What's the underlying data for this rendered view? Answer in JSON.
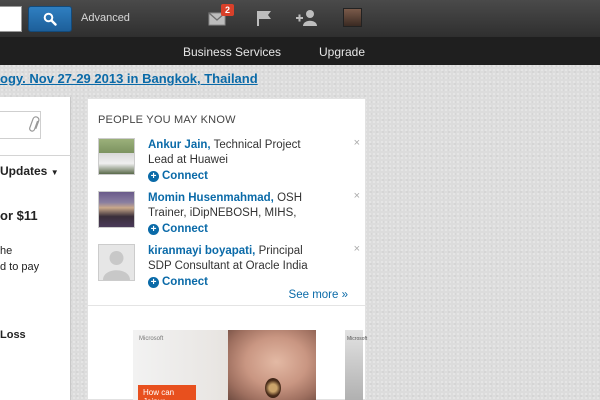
{
  "topbar": {
    "search_button_icon": "search-icon",
    "advanced_label": "Advanced",
    "messages_badge": "2",
    "icons": [
      "messages-icon",
      "flag-icon",
      "add-connection-icon",
      "profile-avatar"
    ]
  },
  "subnav": {
    "business_services": "Business Services",
    "upgrade": "Upgrade"
  },
  "announcement": "ogy. Nov 27-29 2013 in Bangkok, Thailand",
  "left_column": {
    "updates_label": "Updates",
    "price_text": "or $11",
    "line1": "he",
    "line2": "d to pay",
    "loss_label": "Loss"
  },
  "pymk": {
    "heading": "PEOPLE YOU MAY KNOW",
    "people": [
      {
        "name": "Ankur Jain,",
        "headline1": "Technical Project",
        "headline2": "Lead at Huawei",
        "connect": "Connect"
      },
      {
        "name": "Momin Husenmahmad,",
        "headline1": "OSH",
        "headline2": "Trainer, iDipNEBOSH, MIHS,",
        "connect": "Connect"
      },
      {
        "name": "kiranmayi boyapati,",
        "headline1": "Principal",
        "headline2": "SDP Consultant at Oracle India",
        "connect": "Connect"
      }
    ],
    "see_more": "See more »",
    "dismiss": "×"
  },
  "ads": {
    "brand": "Microsoft",
    "cta": "How can Jaipur",
    "side_label": "Microsoft"
  },
  "colors": {
    "accent": "#0a6aa8",
    "topbar": "#3a3a3a",
    "badge": "#d8402a"
  }
}
